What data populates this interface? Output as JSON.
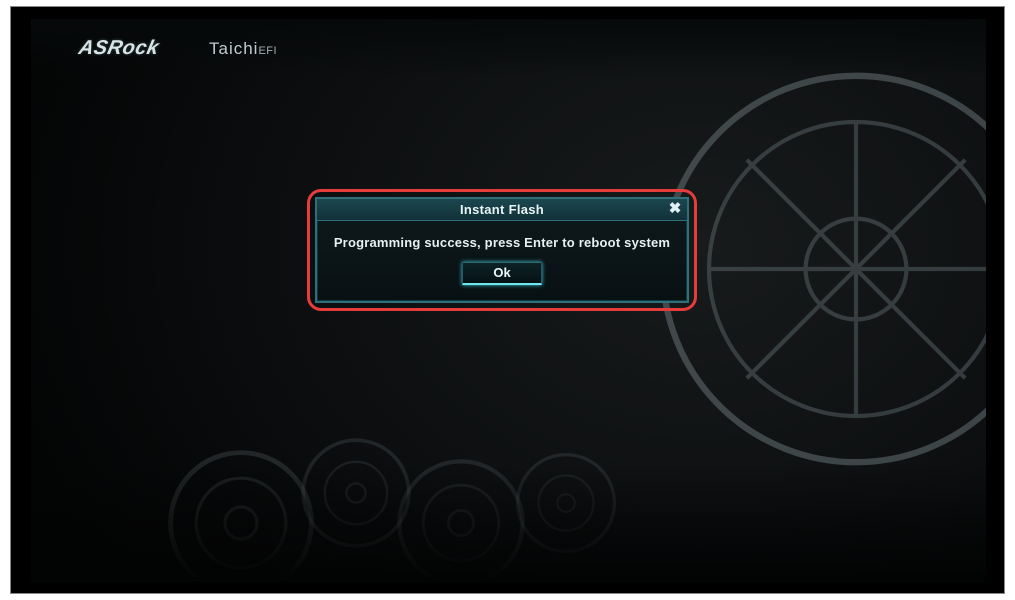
{
  "header": {
    "brand_logo": "ASRock",
    "product_logo": "Taichi",
    "product_logo_suffix": "EFI"
  },
  "dialog": {
    "title": "Instant Flash",
    "message": "Programming success, press Enter to reboot system",
    "ok_label": "Ok",
    "close_glyph": "✖"
  },
  "colors": {
    "accent": "#2e6f7a",
    "highlight_border": "#e73c3c",
    "ok_glow": "#6fe6f0"
  }
}
